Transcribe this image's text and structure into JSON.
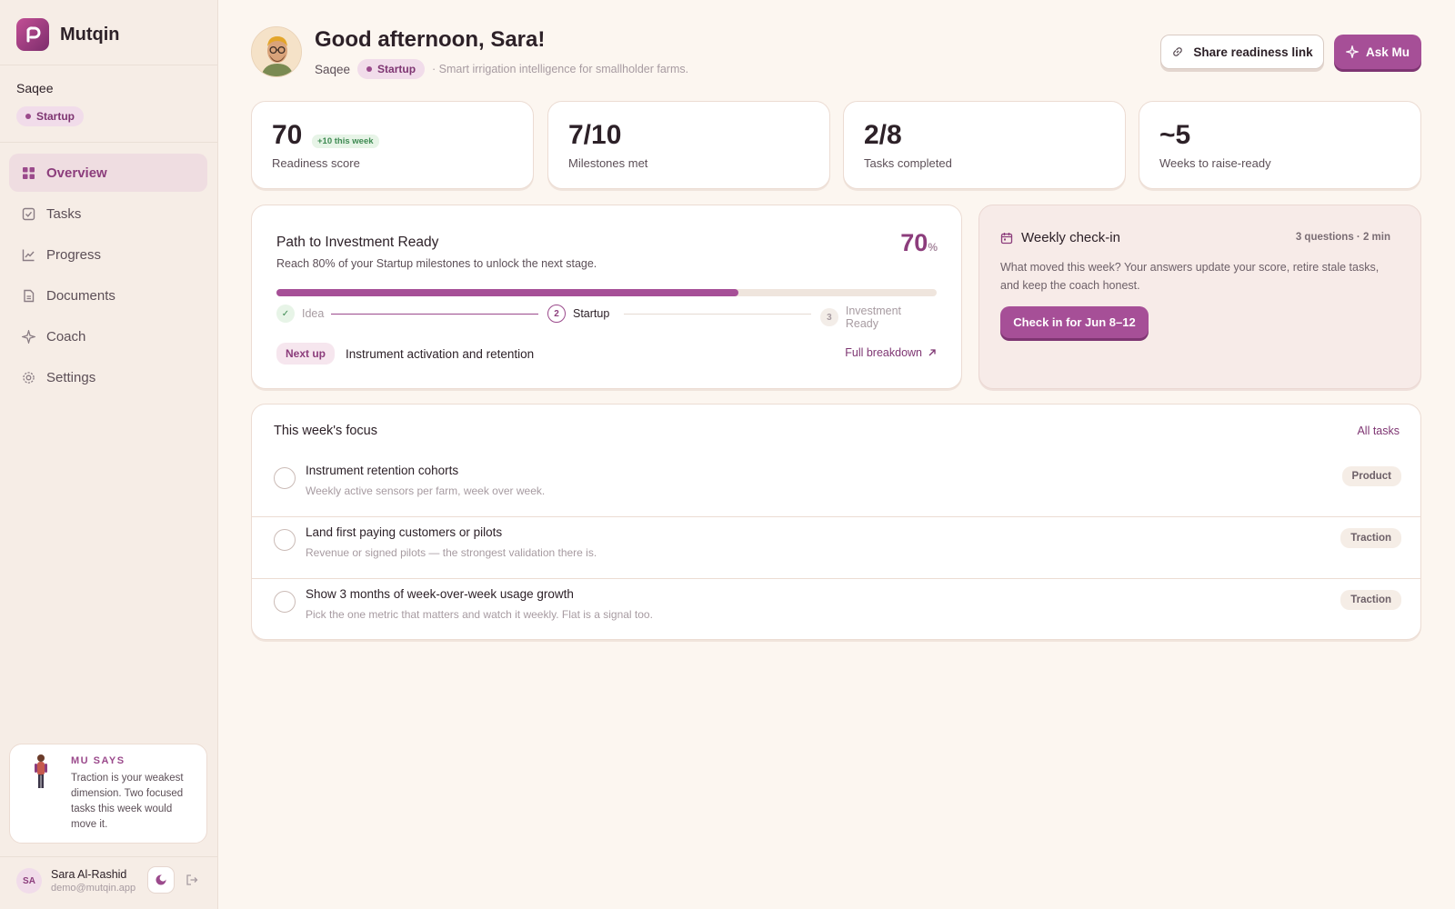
{
  "app": {
    "name": "Mutqin"
  },
  "sidebar": {
    "org_name": "Saqee",
    "stage": "Startup",
    "nav": [
      {
        "label": "Overview",
        "icon": "grid-icon",
        "active": true
      },
      {
        "label": "Tasks",
        "icon": "checkbox-icon",
        "active": false
      },
      {
        "label": "Progress",
        "icon": "chart-line-icon",
        "active": false
      },
      {
        "label": "Documents",
        "icon": "document-icon",
        "active": false
      },
      {
        "label": "Coach",
        "icon": "sparkle-icon",
        "active": false
      },
      {
        "label": "Settings",
        "icon": "gear-icon",
        "active": false
      }
    ],
    "mu_card": {
      "title": "MU SAYS",
      "text": "Traction is your weakest dimension. Two focused tasks this week would move it."
    },
    "user": {
      "initials": "SA",
      "name": "Sara Al-Rashid",
      "email": "demo@mutqin.app"
    }
  },
  "header": {
    "greeting": "Good afternoon, Sara!",
    "org": "Saqee",
    "stage": "Startup",
    "tagline": "· Smart irrigation intelligence for smallholder farms.",
    "share_label": "Share readiness link",
    "ask_label": "Ask Mu"
  },
  "stats": [
    {
      "value": "70",
      "badge": "+10 this week",
      "label": "Readiness score"
    },
    {
      "value": "7/10",
      "label": "Milestones met"
    },
    {
      "value": "2/8",
      "label": "Tasks completed"
    },
    {
      "value": "~5",
      "label": "Weeks to raise-ready"
    }
  ],
  "path": {
    "title": "Path to Investment Ready",
    "description": "Reach 80% of your Startup milestones to unlock the next stage.",
    "percent": "70",
    "percent_unit": "%",
    "progress": 0.7,
    "steps": [
      {
        "num": "✓",
        "label": "Idea",
        "state": "done"
      },
      {
        "num": "2",
        "label": "Startup",
        "state": "current"
      },
      {
        "num": "3",
        "label": "Investment Ready",
        "state": "upcoming"
      }
    ],
    "next_up_label": "Next up",
    "next_up_text": "Instrument activation and retention",
    "breakdown_label": "Full breakdown"
  },
  "checkin": {
    "title": "Weekly check-in",
    "meta": "3 questions · 2 min",
    "text": "What moved this week? Your answers update your score, retire stale tasks, and keep the coach honest.",
    "button": "Check in for Jun 8–12"
  },
  "focus": {
    "title": "This week's focus",
    "all_tasks": "All tasks",
    "tasks": [
      {
        "title": "Instrument retention cohorts",
        "subtitle": "Weekly active sensors per farm, week over week.",
        "tag": "Product"
      },
      {
        "title": "Land first paying customers or pilots",
        "subtitle": "Revenue or signed pilots — the strongest validation there is.",
        "tag": "Traction"
      },
      {
        "title": "Show 3 months of week-over-week usage growth",
        "subtitle": "Pick the one metric that matters and watch it weekly. Flat is a signal too.",
        "tag": "Traction"
      }
    ]
  },
  "colors": {
    "accent": "#a64f97",
    "accent_dark": "#7e3572",
    "background": "#fcf6f0"
  }
}
